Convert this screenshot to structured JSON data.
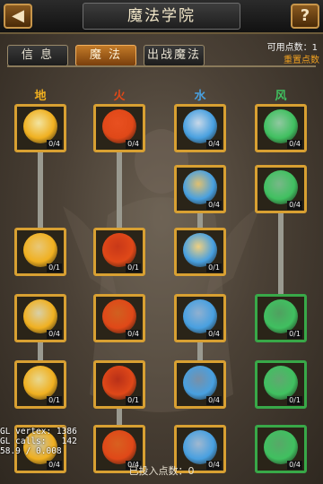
{
  "header": {
    "title": "魔法学院",
    "back_glyph": "◀",
    "help_glyph": "?"
  },
  "tabs": [
    {
      "label": "信 息",
      "active": false
    },
    {
      "label": "魔 法",
      "active": true
    },
    {
      "label": "出战魔法",
      "active": false
    }
  ],
  "points": {
    "available_label": "可用点数：1",
    "reset_label": "重置点数"
  },
  "columns": [
    {
      "name": "地",
      "color": "#f0b020",
      "skills": [
        {
          "level": "0/4",
          "icon": "earth-spirit-icon",
          "accent": "#f2e4a0"
        },
        {
          "level": "0/1",
          "icon": "earth-shield-icon",
          "accent": "#e8c878"
        },
        {
          "level": "0/4",
          "icon": "earth-wolf-icon",
          "accent": "#d8d0a8"
        },
        {
          "level": "0/1",
          "icon": "earth-rays-icon",
          "accent": "#e8d890"
        },
        {
          "level": "0/4",
          "icon": "earth-golem-icon",
          "accent": "#c8c0a0"
        }
      ]
    },
    {
      "name": "火",
      "color": "#e04818",
      "skills": [
        {
          "level": "0/4",
          "icon": "fire-bird-icon",
          "accent": "#e85020"
        },
        {
          "level": "0/1",
          "icon": "fire-swirl-icon",
          "accent": "#c83818"
        },
        {
          "level": "0/4",
          "icon": "fire-dragon-icon",
          "accent": "#d06020"
        },
        {
          "level": "0/1",
          "icon": "fire-ring-icon",
          "accent": "#b83018"
        },
        {
          "level": "0/4",
          "icon": "fire-blast-icon",
          "accent": "#d86020"
        }
      ]
    },
    {
      "name": "水",
      "color": "#48a0e0",
      "skills": [
        {
          "level": "0/4",
          "icon": "water-warrior-icon",
          "accent": "#c8d8e8"
        },
        {
          "level": "0/4",
          "icon": "water-beast-icon",
          "accent": "#e0c070"
        },
        {
          "level": "0/1",
          "icon": "water-shield-icon",
          "accent": "#f0d080"
        },
        {
          "level": "0/4",
          "icon": "water-dragon-icon",
          "accent": "#90b0d0"
        },
        {
          "level": "0/4",
          "icon": "water-serpent-icon",
          "accent": "#7890a8"
        },
        {
          "level": "0/4",
          "icon": "water-knight-icon",
          "accent": "#a0b8d0"
        }
      ]
    },
    {
      "name": "风",
      "color": "#40c060",
      "skills": [
        {
          "level": "0/4",
          "icon": "wind-spiral-icon",
          "accent": "#90c8a0"
        },
        {
          "level": "0/4",
          "icon": "wind-beast-icon",
          "accent": "#78b888"
        },
        {
          "level": "0/1",
          "icon": "wind-cauldron-icon",
          "accent": "#50a060"
        },
        {
          "level": "0/1",
          "icon": "wind-wing-icon",
          "accent": "#60a870"
        },
        {
          "level": "0/4",
          "icon": "wind-vortex-icon",
          "accent": "#58a868"
        }
      ]
    }
  ],
  "footer": {
    "invested_label": "已投入点数：0"
  },
  "debug": {
    "line1": "GL vertex: 1386",
    "line2": "GL calls:   142",
    "line3": "58.9 / 0.008"
  }
}
